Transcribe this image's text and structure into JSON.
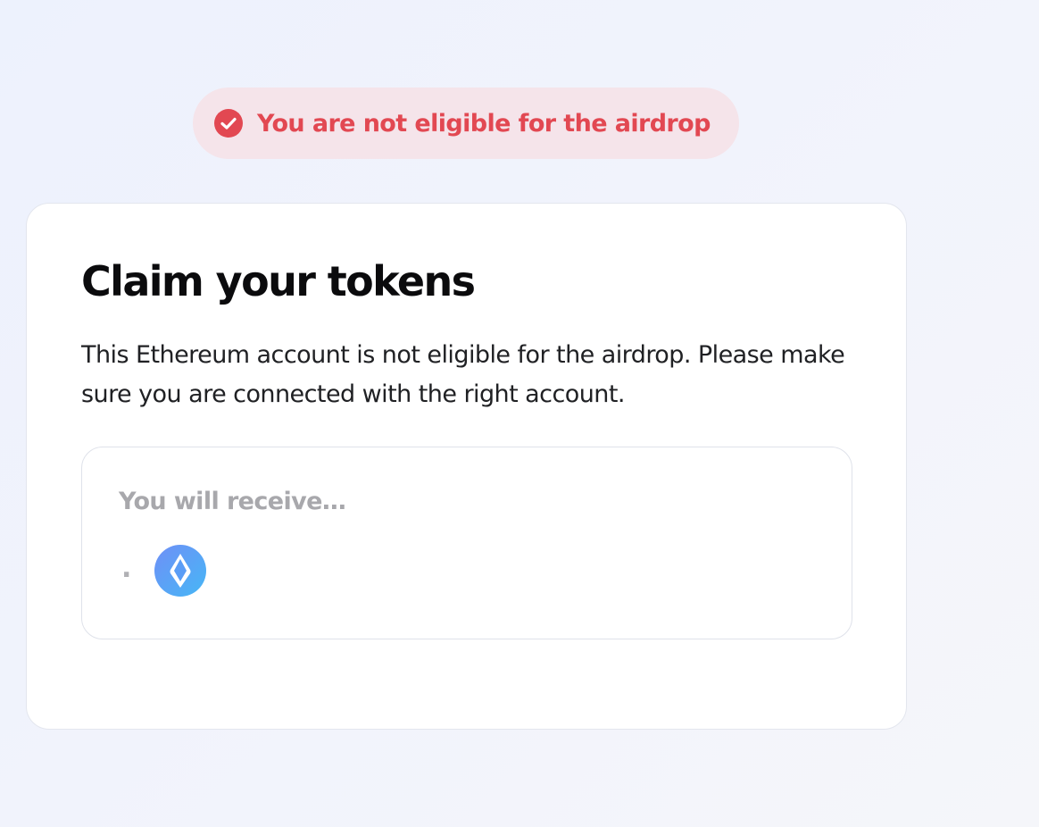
{
  "status": {
    "icon": "check-circle-icon",
    "text": "You are not eligible for the airdrop",
    "color": "#e24852",
    "background": "#f5e4ea"
  },
  "card": {
    "title": "Claim your tokens",
    "description": "This Ethereum account is not eligible for the airdrop. Please make sure you are connected with the right account.",
    "receive": {
      "label": "You will receive…",
      "amount": ".",
      "token_icon": "ens-token-icon"
    }
  }
}
